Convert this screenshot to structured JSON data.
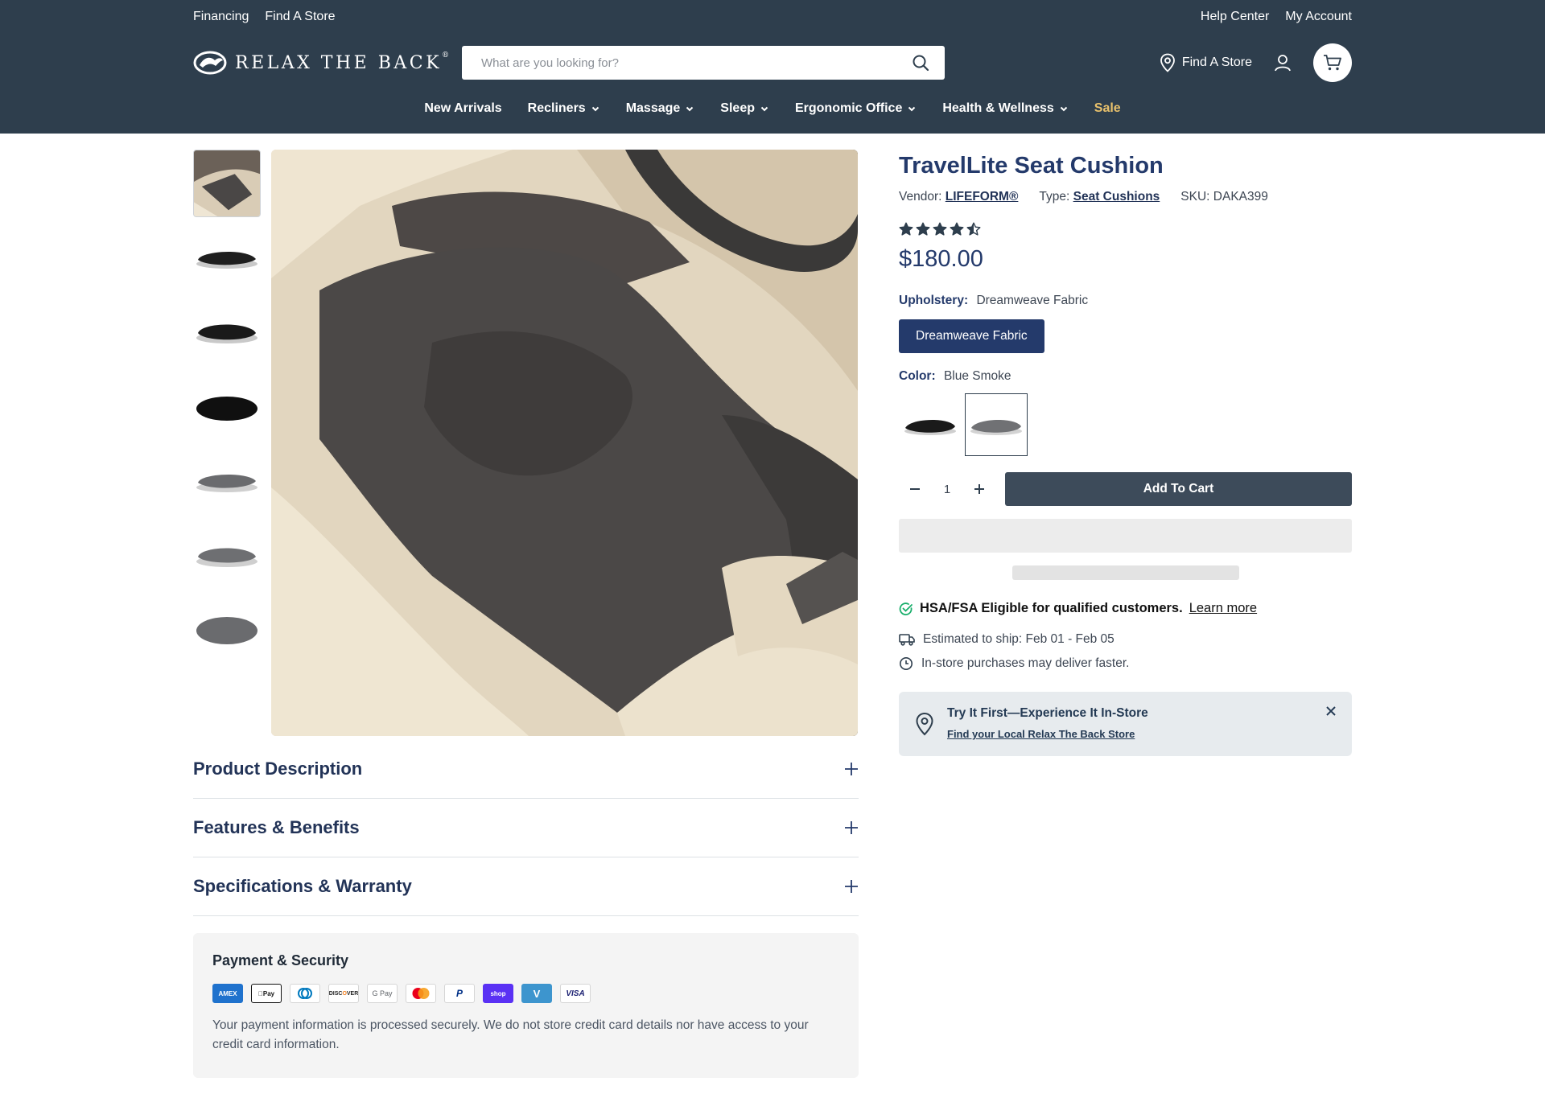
{
  "header": {
    "util_left": [
      "Financing",
      "Find A Store"
    ],
    "util_right": [
      "Help Center",
      "My Account"
    ],
    "logo_text": "RELAX THE BACK",
    "logo_mark": "®",
    "search": {
      "placeholder": "What are you looking for?",
      "icon": "search-icon"
    },
    "find_store": "Find A Store",
    "colors": {
      "bar": "#2e3e4d",
      "sale": "#e8c16c"
    }
  },
  "nav": [
    {
      "label": "New Arrivals",
      "dropdown": false
    },
    {
      "label": "Recliners",
      "dropdown": true
    },
    {
      "label": "Massage",
      "dropdown": true
    },
    {
      "label": "Sleep",
      "dropdown": true
    },
    {
      "label": "Ergonomic Office",
      "dropdown": true
    },
    {
      "label": "Health & Wellness",
      "dropdown": true
    },
    {
      "label": "Sale",
      "dropdown": false
    }
  ],
  "gallery": {
    "thumbnail_count": 7,
    "selected_index": 0
  },
  "accordions": [
    "Product Description",
    "Features & Benefits",
    "Specifications & Warranty"
  ],
  "payment": {
    "title": "Payment & Security",
    "methods": [
      "American Express",
      "Apple Pay",
      "Diners Club",
      "Discover",
      "Google Pay",
      "Mastercard",
      "PayPal",
      "Shop Pay",
      "Venmo",
      "Visa"
    ],
    "note": "Your payment information is processed securely. We do not store credit card details nor have access to your credit card information."
  },
  "product": {
    "title": "TravelLite Seat Cushion",
    "vendor_label": "Vendor:",
    "vendor": "LIFEFORM®",
    "type_label": "Type:",
    "type": "Seat Cushions",
    "sku_label": "SKU:",
    "sku": "DAKA399",
    "rating": 4.5,
    "price": "$180.00",
    "upholstery_label": "Upholstery:",
    "upholstery_value": "Dreamweave Fabric",
    "upholstery_option": "Dreamweave Fabric",
    "color_label": "Color:",
    "color_value": "Blue Smoke",
    "color_swatch_count": 2,
    "color_selected_index": 1,
    "quantity": "1",
    "add_to_cart": "Add To Cart",
    "hsa_text": "HSA/FSA Eligible for qualified customers.",
    "hsa_link": "Learn more",
    "ship_estimate": "Estimated to ship: Feb 01 - Feb 05",
    "instore_note": "In-store purchases may deliver faster."
  },
  "try_it": {
    "title": "Try It First—Experience It In-Store",
    "link": "Find your Local Relax The Back Store"
  }
}
